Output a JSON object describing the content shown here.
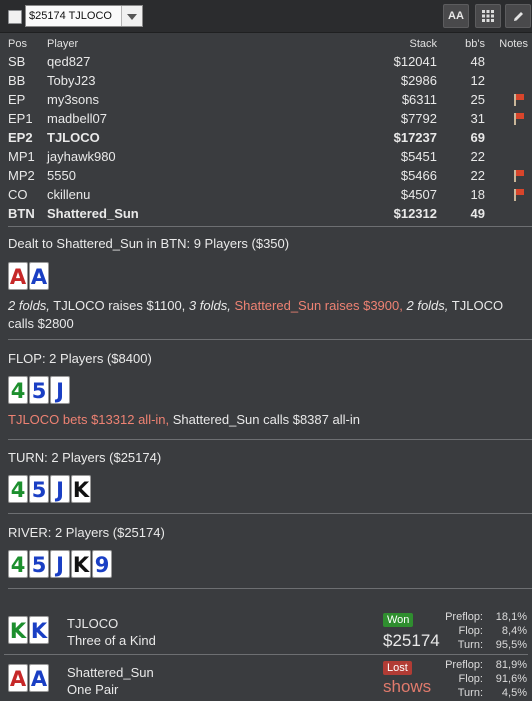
{
  "toolbar": {
    "table_select": "$25174 TJLOCO",
    "font_button": "AA"
  },
  "players": {
    "headers": {
      "pos": "Pos",
      "player": "Player",
      "stack": "Stack",
      "bbs": "bb's",
      "notes": "Notes"
    },
    "rows": [
      {
        "pos": "SB",
        "name": "qed827",
        "stack": "$12041",
        "bb": "48",
        "flag": false,
        "bold": false
      },
      {
        "pos": "BB",
        "name": "TobyJ23",
        "stack": "$2986",
        "bb": "12",
        "flag": false,
        "bold": false
      },
      {
        "pos": "EP",
        "name": "my3sons",
        "stack": "$6311",
        "bb": "25",
        "flag": true,
        "bold": false
      },
      {
        "pos": "EP1",
        "name": "madbell07",
        "stack": "$7792",
        "bb": "31",
        "flag": true,
        "bold": false
      },
      {
        "pos": "EP2",
        "name": "TJLOCO",
        "stack": "$17237",
        "bb": "69",
        "flag": false,
        "bold": true
      },
      {
        "pos": "MP1",
        "name": "jayhawk980",
        "stack": "$5451",
        "bb": "22",
        "flag": false,
        "bold": false
      },
      {
        "pos": "MP2",
        "name": "5550",
        "stack": "$5466",
        "bb": "22",
        "flag": true,
        "bold": false
      },
      {
        "pos": "CO",
        "name": "ckillenu",
        "stack": "$4507",
        "bb": "18",
        "flag": true,
        "bold": false
      },
      {
        "pos": "BTN",
        "name": "Shattered_Sun",
        "stack": "$12312",
        "bb": "49",
        "flag": false,
        "bold": true
      }
    ]
  },
  "preflop": {
    "title": "Dealt to Shattered_Sun in BTN: 9 Players ($350)",
    "cards": [
      {
        "r": "A",
        "s": "h"
      },
      {
        "r": "A",
        "s": "d"
      }
    ],
    "a1": "2 folds,",
    "a2": " TJLOCO raises $1100, ",
    "a3": "3 folds,",
    "a4": " ",
    "a5": "Shattered_Sun raises $3900,",
    "a6": " ",
    "a7": "2 folds,",
    "a8": " TJLOCO calls $2800"
  },
  "flop": {
    "title": "FLOP: 2 Players ($8400)",
    "cards": [
      {
        "r": "4",
        "s": "c"
      },
      {
        "r": "5",
        "s": "d"
      },
      {
        "r": "J",
        "s": "d"
      }
    ],
    "a1": "TJLOCO bets $13312 all-in,",
    "a2": " Shattered_Sun calls $8387 all-in"
  },
  "turn": {
    "title": "TURN: 2 Players ($25174)",
    "cards": [
      {
        "r": "4",
        "s": "c"
      },
      {
        "r": "5",
        "s": "d"
      },
      {
        "r": "J",
        "s": "d"
      },
      {
        "r": "K",
        "s": "s"
      }
    ]
  },
  "river": {
    "title": "RIVER: 2 Players ($25174)",
    "cards": [
      {
        "r": "4",
        "s": "c"
      },
      {
        "r": "5",
        "s": "d"
      },
      {
        "r": "J",
        "s": "d"
      },
      {
        "r": "K",
        "s": "s"
      },
      {
        "r": "9",
        "s": "d"
      }
    ]
  },
  "results": [
    {
      "name": "TJLOCO",
      "hand": "Three of a Kind",
      "cards": [
        {
          "r": "K",
          "s": "c"
        },
        {
          "r": "K",
          "s": "d"
        }
      ],
      "badge": "Won",
      "amount": "$25174",
      "amount_color": "#e9e9e9",
      "stats": [
        {
          "l": "Preflop:",
          "v": "18,1%"
        },
        {
          "l": "Flop:",
          "v": "8,4%"
        },
        {
          "l": "Turn:",
          "v": "95,5%"
        }
      ]
    },
    {
      "name": "Shattered_Sun",
      "hand": "One Pair",
      "cards": [
        {
          "r": "A",
          "s": "h"
        },
        {
          "r": "A",
          "s": "d"
        }
      ],
      "badge": "Lost",
      "amount": "shows",
      "amount_color": "#e07a6c",
      "stats": [
        {
          "l": "Preflop:",
          "v": "81,9%"
        },
        {
          "l": "Flop:",
          "v": "91,6%"
        },
        {
          "l": "Turn:",
          "v": "4,5%"
        }
      ]
    }
  ],
  "colors": {
    "won": "#2f8e2f",
    "lost": "#b13c35",
    "action_red": "#ee8273"
  }
}
